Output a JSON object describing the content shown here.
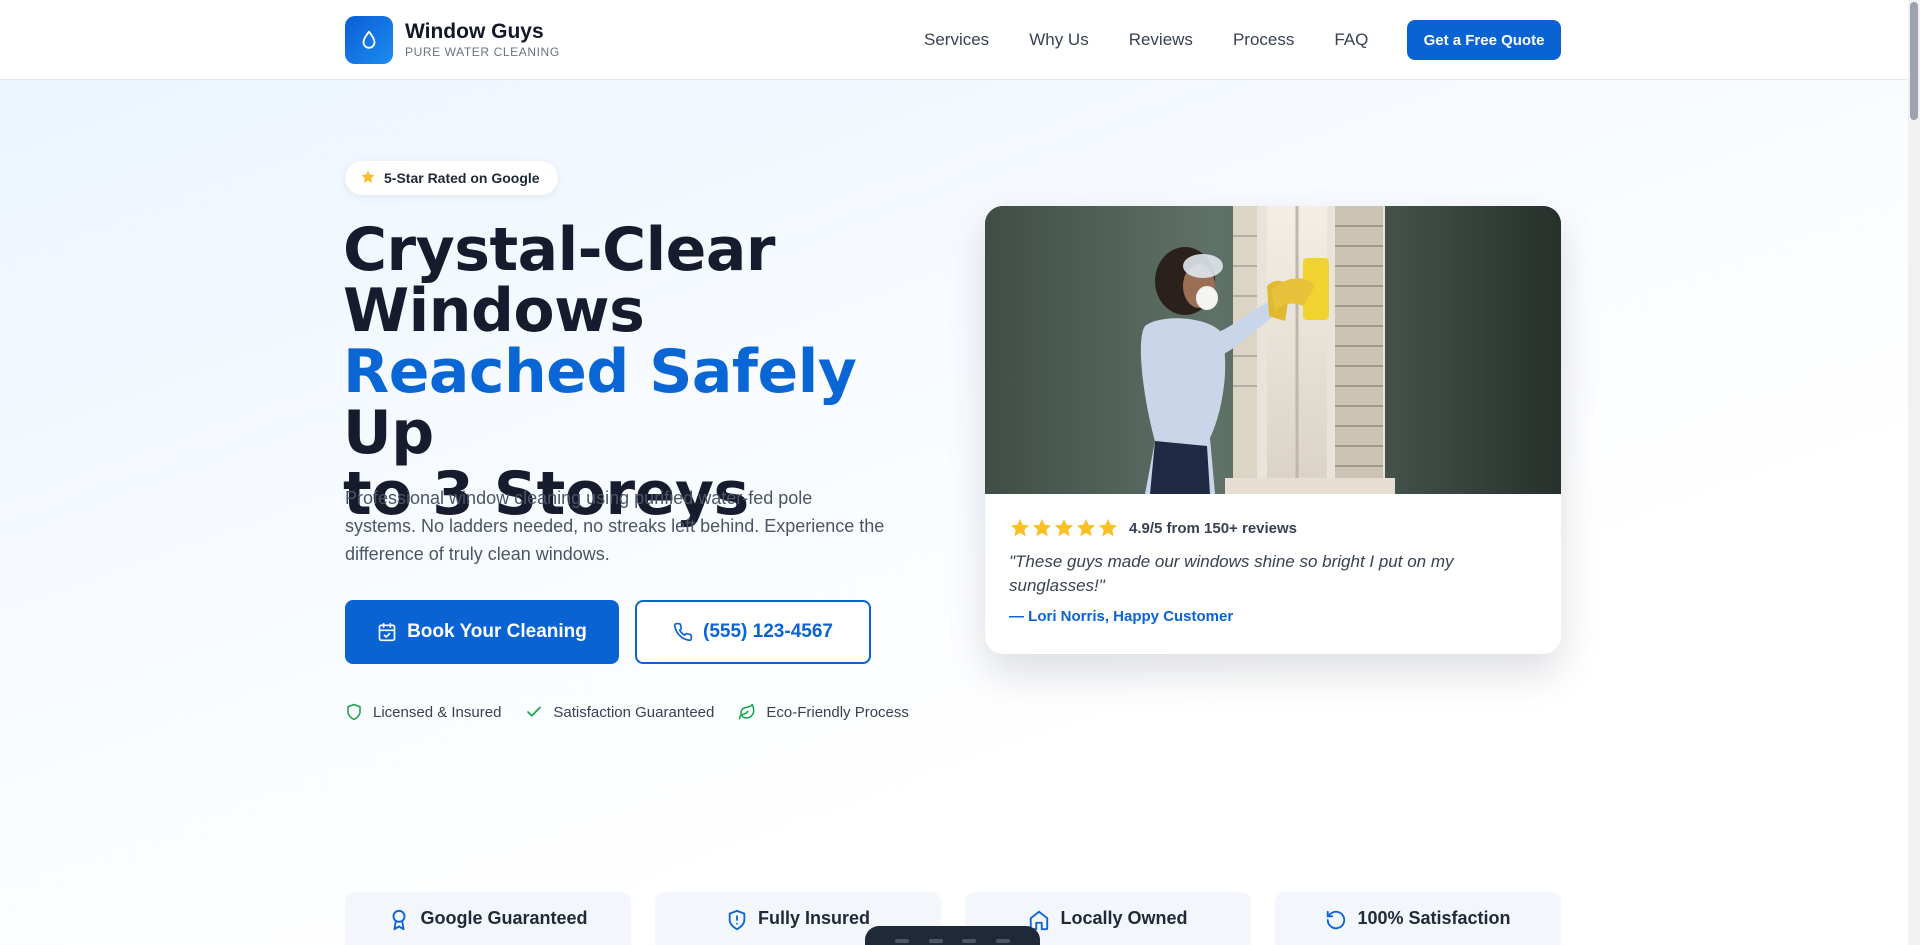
{
  "brand": {
    "name": "Window Guys",
    "tagline": "PURE WATER CLEANING"
  },
  "nav": {
    "links": [
      "Services",
      "Why Us",
      "Reviews",
      "Process",
      "FAQ"
    ],
    "cta": "Get a Free Quote"
  },
  "hero": {
    "badge": "5-Star Rated on Google",
    "title_line1": "Crystal-Clear",
    "title_line2": "Windows",
    "title_accent": "Reached Safely",
    "title_line3_rest": " Up",
    "title_line4": "to 3 Storeys",
    "description": "Professional window cleaning using purified water-fed pole systems. No ladders needed, no streaks left behind. Experience the difference of truly clean windows.",
    "primary_button": "Book Your Cleaning",
    "phone_button": "(555) 123-4567",
    "trust": [
      "Licensed & Insured",
      "Satisfaction Guaranteed",
      "Eco-Friendly Process"
    ]
  },
  "review_card": {
    "rating_text": "4.9/5 from 150+ reviews",
    "stars": 5,
    "quote": "\"These guys made our windows shine so bright I put on my sunglasses!\"",
    "author": "— Lori Norris, Happy Customer"
  },
  "features": [
    "Google Guaranteed",
    "Fully Insured",
    "Locally Owned",
    "100% Satisfaction"
  ],
  "colors": {
    "primary": "#0a63d3",
    "accent_text": "#0a66d4",
    "star": "#fbbf24",
    "trust_icon": "#16a34a"
  },
  "icons": {
    "logo": "water-drop-icon",
    "badge": "star-icon",
    "primary_button": "calendar-check-icon",
    "phone_button": "phone-icon",
    "trust": [
      "shield-icon",
      "check-icon",
      "leaf-icon"
    ],
    "features": [
      "award-icon",
      "shield-alert-icon",
      "home-icon",
      "refresh-icon"
    ]
  }
}
